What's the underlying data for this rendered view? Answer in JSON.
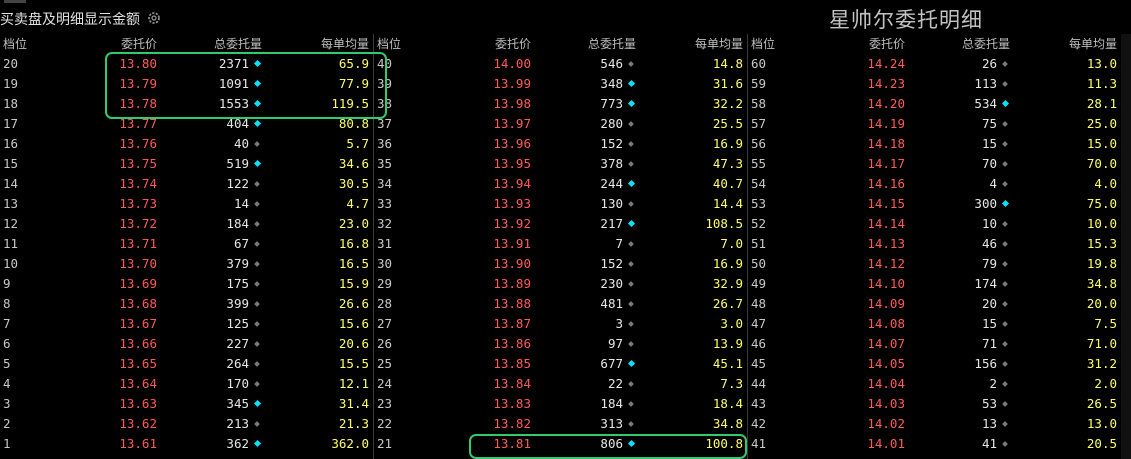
{
  "header": {
    "title": "买卖盘及明细显示金额",
    "watermark": "星帅尔委托明细"
  },
  "columns": [
    "档位",
    "委托价",
    "总委托量",
    "每单均量"
  ],
  "panels": [
    {
      "rows": [
        {
          "level": "20",
          "price": "13.80",
          "volume": "2371",
          "avg": "65.9",
          "big": true
        },
        {
          "level": "19",
          "price": "13.79",
          "volume": "1091",
          "avg": "77.9",
          "big": true
        },
        {
          "level": "18",
          "price": "13.78",
          "volume": "1553",
          "avg": "119.5",
          "big": true
        },
        {
          "level": "17",
          "price": "13.77",
          "volume": "404",
          "avg": "80.8",
          "big": true
        },
        {
          "level": "16",
          "price": "13.76",
          "volume": "40",
          "avg": "5.7",
          "big": false
        },
        {
          "level": "15",
          "price": "13.75",
          "volume": "519",
          "avg": "34.6",
          "big": true
        },
        {
          "level": "14",
          "price": "13.74",
          "volume": "122",
          "avg": "30.5",
          "big": false
        },
        {
          "level": "13",
          "price": "13.73",
          "volume": "14",
          "avg": "4.7",
          "big": false
        },
        {
          "level": "12",
          "price": "13.72",
          "volume": "184",
          "avg": "23.0",
          "big": false
        },
        {
          "level": "11",
          "price": "13.71",
          "volume": "67",
          "avg": "16.8",
          "big": false
        },
        {
          "level": "10",
          "price": "13.70",
          "volume": "379",
          "avg": "16.5",
          "big": false
        },
        {
          "level": "9",
          "price": "13.69",
          "volume": "175",
          "avg": "15.9",
          "big": false
        },
        {
          "level": "8",
          "price": "13.68",
          "volume": "399",
          "avg": "26.6",
          "big": false
        },
        {
          "level": "7",
          "price": "13.67",
          "volume": "125",
          "avg": "15.6",
          "big": false
        },
        {
          "level": "6",
          "price": "13.66",
          "volume": "227",
          "avg": "20.6",
          "big": false
        },
        {
          "level": "5",
          "price": "13.65",
          "volume": "264",
          "avg": "15.5",
          "big": false
        },
        {
          "level": "4",
          "price": "13.64",
          "volume": "170",
          "avg": "12.1",
          "big": false
        },
        {
          "level": "3",
          "price": "13.63",
          "volume": "345",
          "avg": "31.4",
          "big": true
        },
        {
          "level": "2",
          "price": "13.62",
          "volume": "213",
          "avg": "21.3",
          "big": false
        },
        {
          "level": "1",
          "price": "13.61",
          "volume": "362",
          "avg": "362.0",
          "big": true
        }
      ]
    },
    {
      "rows": [
        {
          "level": "40",
          "price": "14.00",
          "volume": "546",
          "avg": "14.8",
          "big": false
        },
        {
          "level": "39",
          "price": "13.99",
          "volume": "348",
          "avg": "31.6",
          "big": true
        },
        {
          "level": "38",
          "price": "13.98",
          "volume": "773",
          "avg": "32.2",
          "big": true
        },
        {
          "level": "37",
          "price": "13.97",
          "volume": "280",
          "avg": "25.5",
          "big": false
        },
        {
          "level": "36",
          "price": "13.96",
          "volume": "152",
          "avg": "16.9",
          "big": false
        },
        {
          "level": "35",
          "price": "13.95",
          "volume": "378",
          "avg": "47.3",
          "big": false
        },
        {
          "level": "34",
          "price": "13.94",
          "volume": "244",
          "avg": "40.7",
          "big": true
        },
        {
          "level": "33",
          "price": "13.93",
          "volume": "130",
          "avg": "14.4",
          "big": false
        },
        {
          "level": "32",
          "price": "13.92",
          "volume": "217",
          "avg": "108.5",
          "big": true
        },
        {
          "level": "31",
          "price": "13.91",
          "volume": "7",
          "avg": "7.0",
          "big": false
        },
        {
          "level": "30",
          "price": "13.90",
          "volume": "152",
          "avg": "16.9",
          "big": false
        },
        {
          "level": "29",
          "price": "13.89",
          "volume": "230",
          "avg": "32.9",
          "big": false
        },
        {
          "level": "28",
          "price": "13.88",
          "volume": "481",
          "avg": "26.7",
          "big": false
        },
        {
          "level": "27",
          "price": "13.87",
          "volume": "3",
          "avg": "3.0",
          "big": false
        },
        {
          "level": "26",
          "price": "13.86",
          "volume": "97",
          "avg": "13.9",
          "big": false
        },
        {
          "level": "25",
          "price": "13.85",
          "volume": "677",
          "avg": "45.1",
          "big": true
        },
        {
          "level": "24",
          "price": "13.84",
          "volume": "22",
          "avg": "7.3",
          "big": false
        },
        {
          "level": "23",
          "price": "13.83",
          "volume": "184",
          "avg": "18.4",
          "big": false
        },
        {
          "level": "22",
          "price": "13.82",
          "volume": "313",
          "avg": "34.8",
          "big": false
        },
        {
          "level": "21",
          "price": "13.81",
          "volume": "806",
          "avg": "100.8",
          "big": true
        }
      ]
    },
    {
      "rows": [
        {
          "level": "60",
          "price": "14.24",
          "volume": "26",
          "avg": "13.0",
          "big": false
        },
        {
          "level": "59",
          "price": "14.23",
          "volume": "113",
          "avg": "11.3",
          "big": false
        },
        {
          "level": "58",
          "price": "14.20",
          "volume": "534",
          "avg": "28.1",
          "big": true
        },
        {
          "level": "57",
          "price": "14.19",
          "volume": "75",
          "avg": "25.0",
          "big": false
        },
        {
          "level": "56",
          "price": "14.18",
          "volume": "15",
          "avg": "15.0",
          "big": false
        },
        {
          "level": "55",
          "price": "14.17",
          "volume": "70",
          "avg": "70.0",
          "big": false
        },
        {
          "level": "54",
          "price": "14.16",
          "volume": "4",
          "avg": "4.0",
          "big": false
        },
        {
          "level": "53",
          "price": "14.15",
          "volume": "300",
          "avg": "75.0",
          "big": true
        },
        {
          "level": "52",
          "price": "14.14",
          "volume": "10",
          "avg": "10.0",
          "big": false
        },
        {
          "level": "51",
          "price": "14.13",
          "volume": "46",
          "avg": "15.3",
          "big": false
        },
        {
          "level": "50",
          "price": "14.12",
          "volume": "79",
          "avg": "19.8",
          "big": false
        },
        {
          "level": "49",
          "price": "14.10",
          "volume": "174",
          "avg": "34.8",
          "big": false
        },
        {
          "level": "48",
          "price": "14.09",
          "volume": "20",
          "avg": "20.0",
          "big": false
        },
        {
          "level": "47",
          "price": "14.08",
          "volume": "15",
          "avg": "7.5",
          "big": false
        },
        {
          "level": "46",
          "price": "14.07",
          "volume": "71",
          "avg": "71.0",
          "big": false
        },
        {
          "level": "45",
          "price": "14.05",
          "volume": "156",
          "avg": "31.2",
          "big": false
        },
        {
          "level": "44",
          "price": "14.04",
          "volume": "2",
          "avg": "2.0",
          "big": false
        },
        {
          "level": "43",
          "price": "14.03",
          "volume": "53",
          "avg": "26.5",
          "big": false
        },
        {
          "level": "42",
          "price": "14.02",
          "volume": "13",
          "avg": "13.0",
          "big": false
        },
        {
          "level": "41",
          "price": "14.01",
          "volume": "41",
          "avg": "20.5",
          "big": false
        }
      ]
    }
  ],
  "colors": {
    "price": "#ff5a5a",
    "avg": "#ffff66",
    "volume": "#e6e6e6",
    "big_dot": "#00e5ff",
    "small_dot": "#7a7a7a",
    "highlight": "#2ecc71"
  }
}
